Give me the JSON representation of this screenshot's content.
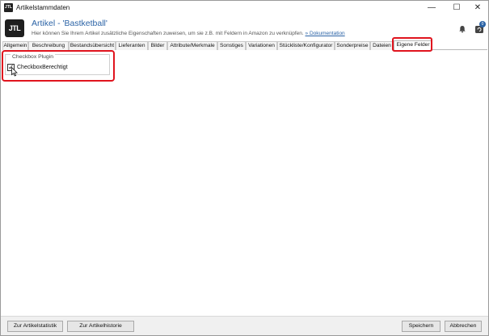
{
  "window": {
    "app_icon": "JTL",
    "title": "Artikelstammdaten",
    "controls": {
      "minimize": "—",
      "maximize": "☐",
      "close": "✕"
    }
  },
  "header": {
    "logo": "JTL",
    "article_title": "Artikel - 'Bastketball'",
    "subtitle": "Hier können Sie Ihrem Artikel zusätzliche Eigenschaften zuweisen, um sie z.B. mit Feldern in Amazon zu verknüpfen.",
    "doc_link": "» Dokumentation",
    "notification_badge": "0",
    "icons": {
      "bell": "bell-icon",
      "updates": "updates-icon"
    }
  },
  "tabs": [
    {
      "label": "Allgemein"
    },
    {
      "label": "Beschreibung"
    },
    {
      "label": "Bestandsübersicht"
    },
    {
      "label": "Lieferanten"
    },
    {
      "label": "Bilder"
    },
    {
      "label": "Attribute/Merkmale"
    },
    {
      "label": "Sonstiges"
    },
    {
      "label": "Variationen"
    },
    {
      "label": "Stückliste/Konfigurator"
    },
    {
      "label": "Sonderpreise"
    },
    {
      "label": "Dateien"
    },
    {
      "label": "Eigene Felder",
      "active": true
    }
  ],
  "content": {
    "group_title": "Checkbox Plugin",
    "checkbox": {
      "label": "CheckboxBerechtigt",
      "checked": true
    }
  },
  "footer": {
    "buttons": {
      "statistik": "Zur Artikelstatistik",
      "historie": "Zur Artikelhistorie",
      "save": "Speichern",
      "cancel": "Abbrechen"
    }
  },
  "colors": {
    "accent": "#2b63a6",
    "highlight": "#e0141e"
  }
}
